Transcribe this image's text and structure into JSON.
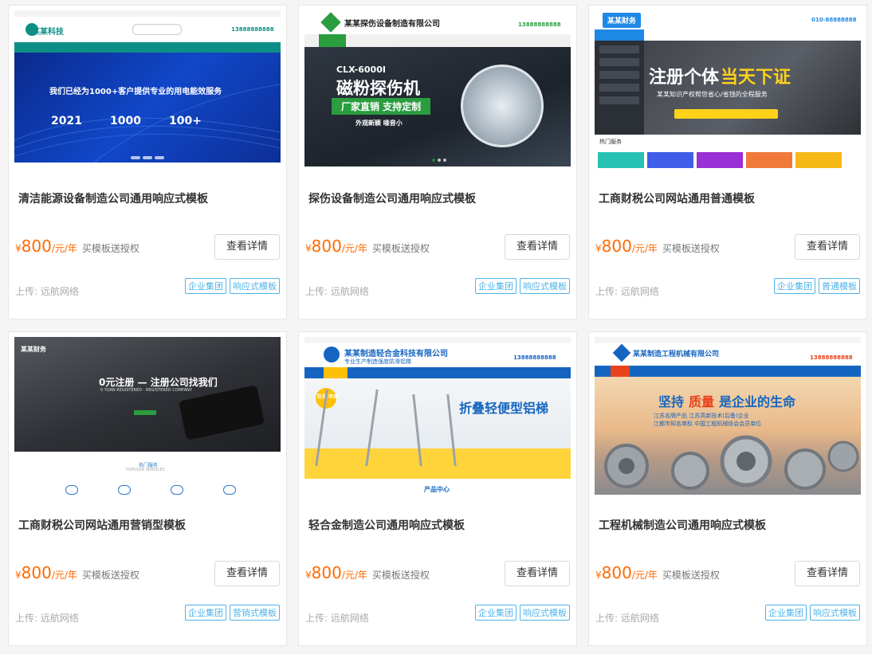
{
  "cards": [
    {
      "title": "清洁能源设备制造公司通用响应式模板",
      "currency": "¥",
      "price": "800",
      "unit": "/元/年",
      "gift": "买模板送授权",
      "detail_label": "查看详情",
      "uploader_label": "上传:",
      "uploader": "远航网络",
      "tags": [
        "企业集团",
        "响应式模板"
      ],
      "thumb": {
        "logo": "某某科技",
        "phone": "13888888888",
        "banner_text": "我们已经为1000+客户提供专业的用电能效服务",
        "stats": [
          "2021",
          "1000",
          "100+"
        ]
      }
    },
    {
      "title": "探伤设备制造公司通用响应式模板",
      "currency": "¥",
      "price": "800",
      "unit": "/元/年",
      "gift": "买模板送授权",
      "detail_label": "查看详情",
      "uploader_label": "上传:",
      "uploader": "远航网络",
      "tags": [
        "企业集团",
        "响应式模板"
      ],
      "thumb": {
        "logo": "某某探伤设备制造有限公司",
        "phone": "13888888888",
        "model": "CLX-6000I",
        "headline": "磁粉探伤机",
        "badge": "厂家直销 支持定制",
        "sub": "外观新颖 噪音小"
      }
    },
    {
      "title": "工商财税公司网站通用普通模板",
      "currency": "¥",
      "price": "800",
      "unit": "/元/年",
      "gift": "买模板送授权",
      "detail_label": "查看详情",
      "uploader_label": "上传:",
      "uploader": "远航网络",
      "tags": [
        "企业集团",
        "普通模板"
      ],
      "thumb": {
        "logo": "某某财务",
        "phone": "010-88888888",
        "headline_a": "注册个体",
        "headline_b": "当天下证",
        "sub": "某某知识产权帮您省心/省钱的全程服务",
        "hot": "热门服务"
      }
    },
    {
      "title": "工商财税公司网站通用营销型模板",
      "currency": "¥",
      "price": "800",
      "unit": "/元/年",
      "gift": "买模板送授权",
      "detail_label": "查看详情",
      "uploader_label": "上传:",
      "uploader": "远航网络",
      "tags": [
        "企业集团",
        "营销式模板"
      ],
      "thumb": {
        "logo": "某某财务",
        "headline": "0元注册 — 注册公司找我们",
        "sub": "0 YUAN REGISTERED · REGISTERED COMPANY",
        "hot": "热门服务",
        "hot_en": "POPULER SERVICES"
      }
    },
    {
      "title": "轻合金制造公司通用响应式模板",
      "currency": "¥",
      "price": "800",
      "unit": "/元/年",
      "gift": "买模板送授权",
      "detail_label": "查看详情",
      "uploader_label": "上传:",
      "uploader": "远航网络",
      "tags": [
        "企业集团",
        "响应式模板"
      ],
      "thumb": {
        "logo": "某某制造轻合金科技有限公司",
        "logo_sub": "专业生产制造强度防滑铝梯",
        "phone": "13888888888",
        "headline": "折叠轻便型铝梯",
        "badge": "防滑 牢固",
        "footer": "产品中心"
      }
    },
    {
      "title": "工程机械制造公司通用响应式模板",
      "currency": "¥",
      "price": "800",
      "unit": "/元/年",
      "gift": "买模板送授权",
      "detail_label": "查看详情",
      "uploader_label": "上传:",
      "uploader": "远航网络",
      "tags": [
        "企业集团",
        "响应式模板"
      ],
      "thumb": {
        "logo": "某某制造工程机械有限公司",
        "phone": "13888888888",
        "headline_a": "坚持",
        "headline_b": "质量",
        "headline_c": "是企业的生命",
        "sub1": "江苏名牌产品 江苏高新技术(后备)企业",
        "sub2": "江都市知名商标 中国工程机械协会会员单位"
      }
    }
  ],
  "colors": {
    "price": "#ff6a00",
    "tag": "#4fb3e8",
    "teal": "#0e8f86",
    "green": "#2a9d3f",
    "blue": "#1565c0",
    "orange": "#e8431b"
  }
}
